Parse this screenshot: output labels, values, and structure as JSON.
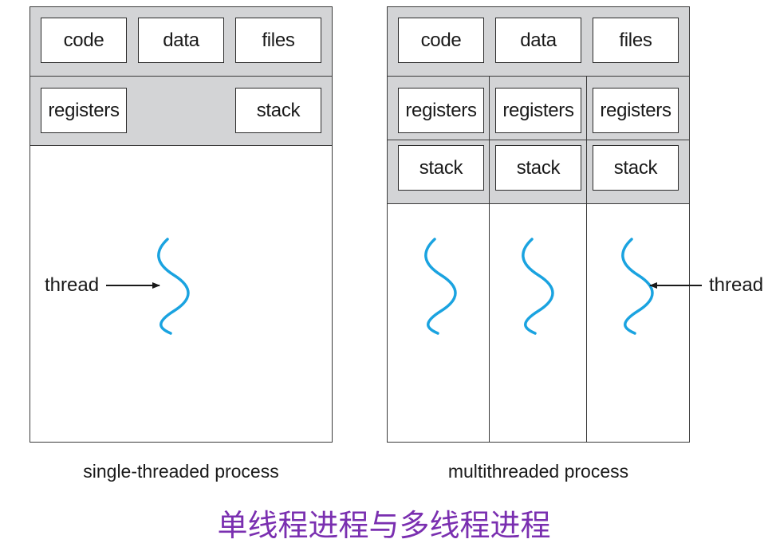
{
  "single": {
    "code": "code",
    "data": "data",
    "files": "files",
    "registers": "registers",
    "stack": "stack",
    "thread_label": "thread",
    "caption": "single-threaded process"
  },
  "multi": {
    "code": "code",
    "data": "data",
    "files": "files",
    "registers": [
      "registers",
      "registers",
      "registers"
    ],
    "stacks": [
      "stack",
      "stack",
      "stack"
    ],
    "thread_label": "thread",
    "caption": "multithreaded process"
  },
  "title": "单线程进程与多线程进程",
  "colors": {
    "thread": "#1aa3e0",
    "band": "#d3d4d6",
    "title": "#7a2fb0"
  }
}
